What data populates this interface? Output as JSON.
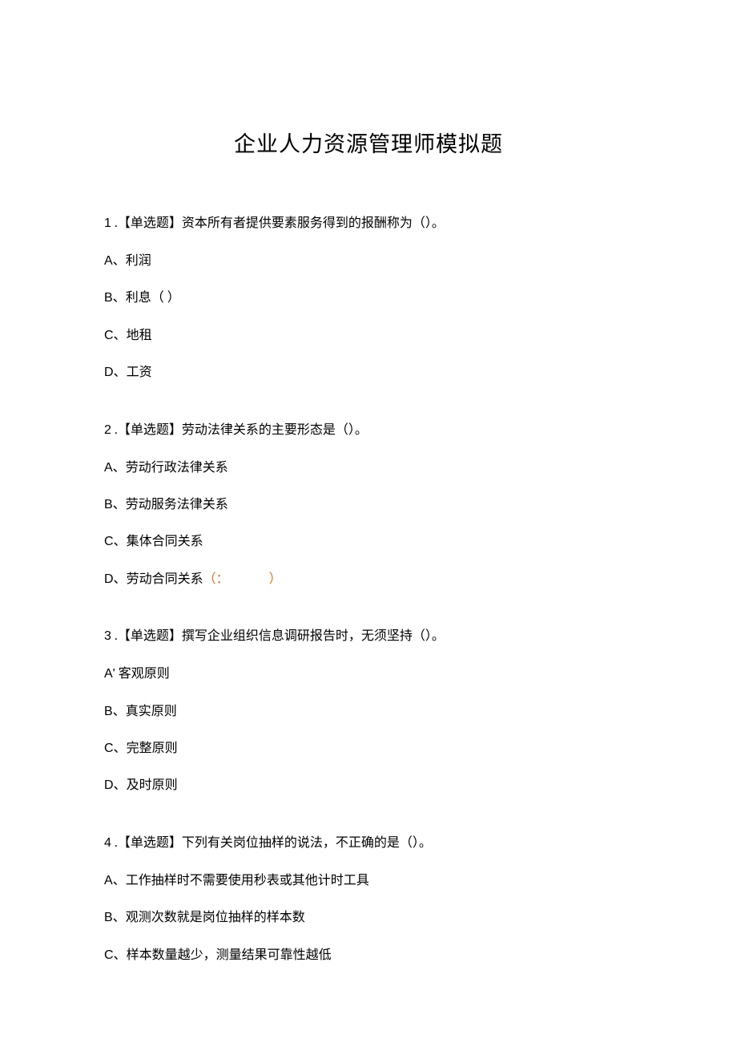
{
  "title": "企业人力资源管理师模拟题",
  "questions": [
    {
      "number": "1",
      "tag": "【单选题】",
      "text": "资本所有者提供要素服务得到的报酬称为（）。",
      "options": [
        {
          "letter": "A、",
          "text": "利润",
          "mark": ""
        },
        {
          "letter": "B、",
          "text": "利息",
          "mark": "paren"
        },
        {
          "letter": "C、",
          "text": "地租",
          "mark": ""
        },
        {
          "letter": "D、",
          "text": "工资",
          "mark": ""
        }
      ]
    },
    {
      "number": "2",
      "tag": "【单选题】",
      "text": "劳动法律关系的主要形态是（）。",
      "options": [
        {
          "letter": "A、",
          "text": "劳动行政法律关系",
          "mark": ""
        },
        {
          "letter": "B、",
          "text": "劳动服务法律关系",
          "mark": ""
        },
        {
          "letter": "C、",
          "text": "集体合同关系",
          "mark": ""
        },
        {
          "letter": "D、",
          "text": "劳动合同关系",
          "mark": "paren-orange"
        }
      ]
    },
    {
      "number": "3",
      "tag": "【单选题】",
      "text": "撰写企业组织信息调研报告时，无须坚持（）。",
      "options": [
        {
          "letter": "A'",
          "text": " 客观原则",
          "mark": ""
        },
        {
          "letter": "B、",
          "text": "真实原则",
          "mark": ""
        },
        {
          "letter": "C、",
          "text": "完整原则",
          "mark": ""
        },
        {
          "letter": "D、",
          "text": "及时原则",
          "mark": ""
        }
      ]
    },
    {
      "number": "4",
      "tag": "【单选题】",
      "text": "下列有关岗位抽样的说法，不正确的是（）。",
      "options": [
        {
          "letter": "A、",
          "text": "工作抽样时不需要使用秒表或其他计时工具",
          "mark": ""
        },
        {
          "letter": "B、",
          "text": "观测次数就是岗位抽样的样本数",
          "mark": ""
        },
        {
          "letter": "C、",
          "text": "样本数量越少，测量结果可靠性越低",
          "mark": ""
        }
      ]
    }
  ],
  "paren_plain": "（           ）",
  "paren_orange_open": "（：",
  "paren_orange_close": "）"
}
